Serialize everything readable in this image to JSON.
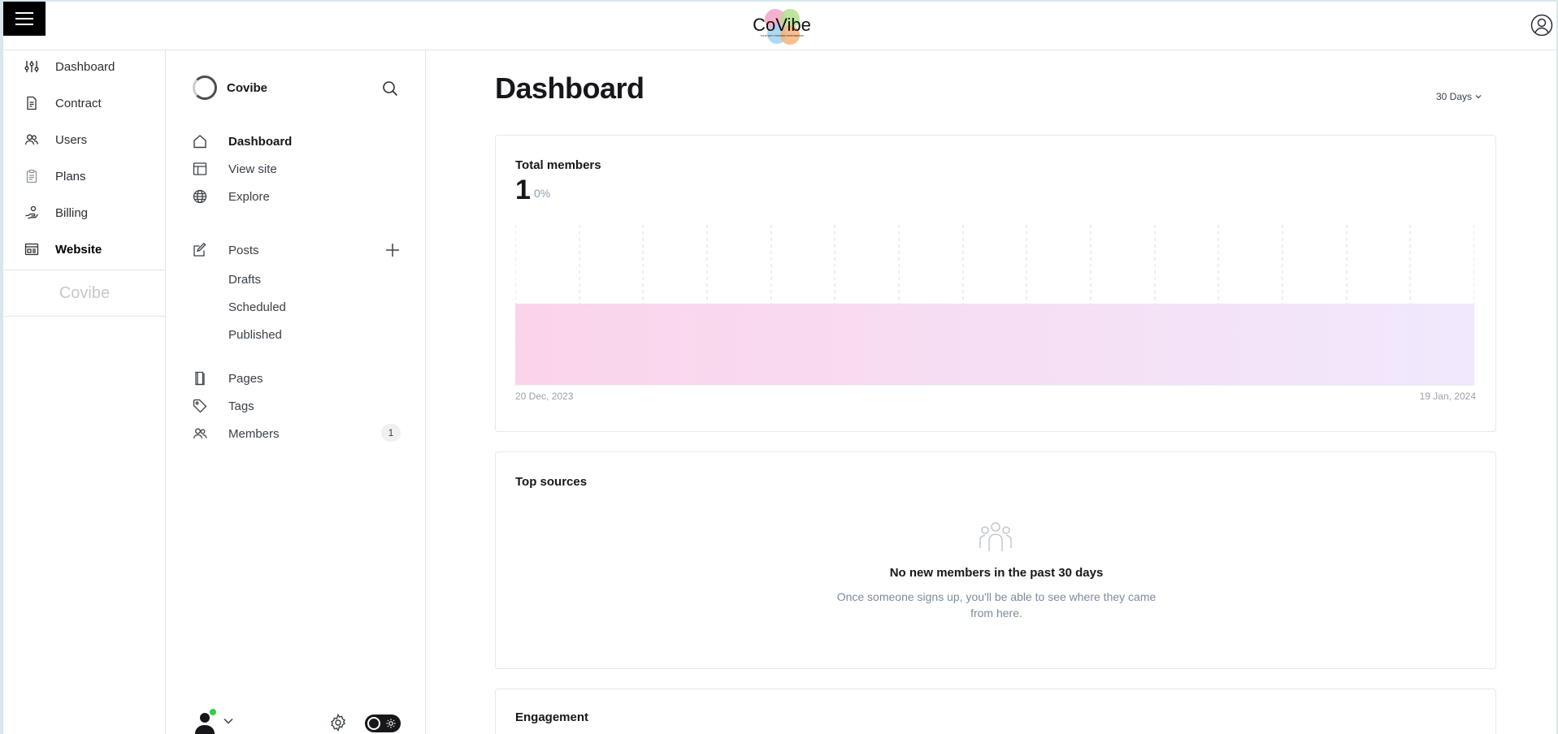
{
  "app": {
    "brand_logo_text": "CoVibe",
    "brand_tagline": "YOUR WAY TOWARDS PARTNERSHIP",
    "accent_pink": "#ec4899",
    "accent_purple": "#a855f7"
  },
  "topbar": {
    "menu_icon": "hamburger-icon",
    "user_icon": "user-circle-icon"
  },
  "left_nav": {
    "items": [
      {
        "label": "Dashboard",
        "icon": "sliders-icon",
        "active": false
      },
      {
        "label": "Contract",
        "icon": "document-icon",
        "active": false
      },
      {
        "label": "Users",
        "icon": "users-icon",
        "active": false
      },
      {
        "label": "Plans",
        "icon": "clipboard-icon",
        "active": false
      },
      {
        "label": "Billing",
        "icon": "billing-hand-icon",
        "active": false
      },
      {
        "label": "Website",
        "icon": "browser-icon",
        "active": true
      }
    ],
    "footer_brand": "Covibe"
  },
  "site_sidebar": {
    "site_name": "Covibe",
    "nav": [
      {
        "label": "Dashboard",
        "icon": "home-icon",
        "active": true
      },
      {
        "label": "View site",
        "icon": "layout-icon",
        "active": false
      },
      {
        "label": "Explore",
        "icon": "globe-icon",
        "active": false
      }
    ],
    "posts": {
      "label": "Posts",
      "icon": "edit-icon",
      "sub": [
        "Drafts",
        "Scheduled",
        "Published"
      ]
    },
    "more": [
      {
        "label": "Pages",
        "icon": "pages-icon"
      },
      {
        "label": "Tags",
        "icon": "tag-icon"
      },
      {
        "label": "Members",
        "icon": "members-icon",
        "count": "1"
      }
    ]
  },
  "main": {
    "title": "Dashboard",
    "range_label": "30 Days",
    "total_members": {
      "title": "Total members",
      "value": "1",
      "delta": "0%",
      "start_date": "20 Dec, 2023",
      "end_date": "19 Jan, 2024"
    },
    "top_sources": {
      "title": "Top sources",
      "empty_title": "No new members in the past 30 days",
      "empty_text": "Once someone signs up, you'll be able to see where they came from here."
    },
    "engagement": {
      "title": "Engagement"
    }
  }
}
